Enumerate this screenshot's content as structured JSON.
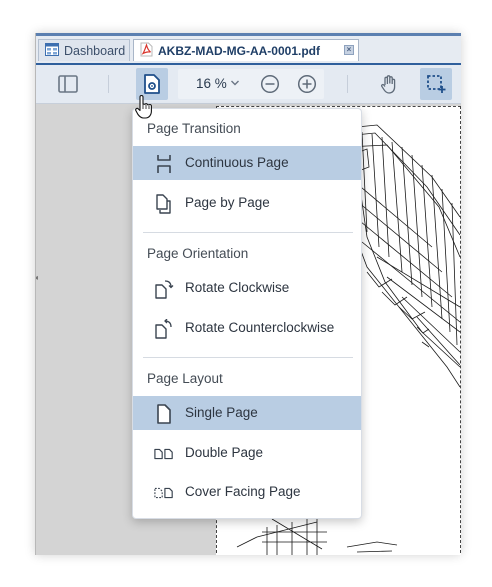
{
  "tabs": [
    {
      "label": "Dashboard",
      "icon": "dashboard-grid-icon"
    },
    {
      "label": "AKBZ-MAD-MG-AA-0001.pdf",
      "icon": "pdf-file-icon"
    }
  ],
  "toolbar": {
    "zoom_value": "16 %",
    "buttons": [
      "sidebar-toggle",
      "page-display-settings",
      "zoom-out",
      "zoom-in",
      "pan-hand",
      "area-select"
    ]
  },
  "menu": {
    "sections": [
      {
        "title": "Page Transition",
        "items": [
          {
            "label": "Continuous Page",
            "icon": "continuous-page-icon",
            "selected": true
          },
          {
            "label": "Page by Page",
            "icon": "page-by-page-icon",
            "selected": false
          }
        ]
      },
      {
        "title": "Page Orientation",
        "items": [
          {
            "label": "Rotate Clockwise",
            "icon": "rotate-clockwise-icon",
            "selected": false
          },
          {
            "label": "Rotate Counterclockwise",
            "icon": "rotate-counterclockwise-icon",
            "selected": false
          }
        ]
      },
      {
        "title": "Page Layout",
        "items": [
          {
            "label": "Single Page",
            "icon": "single-page-icon",
            "selected": true
          },
          {
            "label": "Double Page",
            "icon": "double-page-icon",
            "selected": false
          },
          {
            "label": "Cover Facing Page",
            "icon": "cover-facing-page-icon",
            "selected": false
          }
        ]
      }
    ]
  },
  "colors": {
    "accent": "#2f5f9c",
    "selected_bg": "#b9cde3",
    "toolbar_bg": "#e4eaf2",
    "pdf_red": "#d9342b"
  }
}
